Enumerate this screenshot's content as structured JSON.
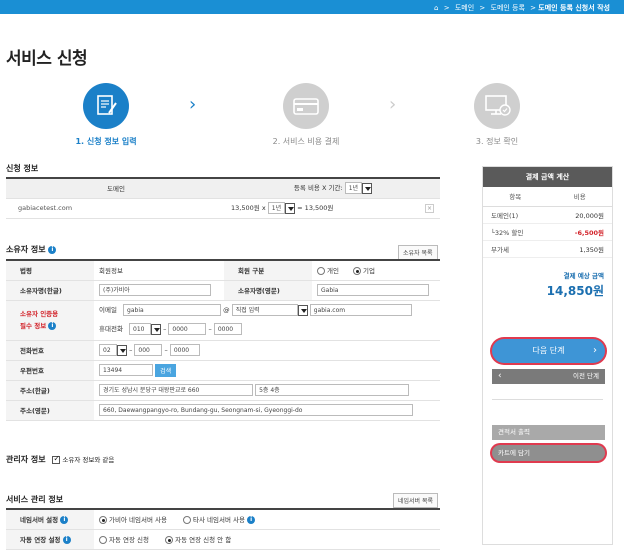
{
  "breadcrumb": {
    "items": [
      "도메인",
      "도메인 등록"
    ],
    "current": "도메인 등록 신청서 작성",
    "sep": ">"
  },
  "page": {
    "title": "서비스 신청"
  },
  "steps": [
    {
      "label": "1. 신청 정보 입력"
    },
    {
      "label": "2. 서비스 비용 결제"
    },
    {
      "label": "3. 정보 확인"
    }
  ],
  "apply": {
    "title": "신청 정보",
    "col_domain": "도메인",
    "col_fee": "등록 비용 X 기간:",
    "period_header": "1년",
    "domain": "gabiacetest.com",
    "price": "13,500원",
    "times": "x",
    "period": "1년",
    "result": "= 13,500원"
  },
  "owner": {
    "title": "소유자 정보",
    "list_button": "소유자 목록",
    "type_label": "법령",
    "type_value": "회원정보",
    "member_type_label": "회원 구분",
    "opt_individual": "개인",
    "opt_company": "기업",
    "name_kr_label": "소유자명(한글)",
    "name_kr": "(주)가비아",
    "name_en_label": "소유자명(영문)",
    "name_en": "Gabia",
    "auth_label_line1": "소유자 인증용",
    "auth_label_line2": "필수 정보",
    "email_label": "이메일",
    "email_id": "gabia",
    "at": "@",
    "email_direct": "직접 입력",
    "email_domain": "gabia.com",
    "mobile_label": "휴대전화",
    "mobile_1": "010",
    "mobile_2": "0000",
    "mobile_3": "0000",
    "dash": "–",
    "phone_label": "전화번호",
    "phone_1": "02",
    "phone_2": "000",
    "phone_3": "0000",
    "zip_label": "우편번호",
    "zip": "13494",
    "search_button": "검색",
    "addr_kr_label": "주소(한글)",
    "addr_kr_1": "경기도 성남시 분당구 대왕판교로 660",
    "addr_kr_2": "5층 4층",
    "addr_en_label": "주소(영문)",
    "addr_en": "660, Daewangpangyo-ro, Bundang-gu, Seongnam-si, Gyeonggi-do"
  },
  "admin": {
    "title": "관리자 정보",
    "same_label": "소유자 정보와 같음"
  },
  "service": {
    "title": "서비스 관리 정보",
    "list_button": "네임서버 목록",
    "ns_label": "네임서버 설정",
    "ns_opt1": "가비아 네임서버 사용",
    "ns_opt2": "타사 네임서버 사용",
    "renew_label": "자동 연장 설정",
    "renew_opt1": "자동 연장 신청",
    "renew_opt2": "자동 연장 신청 안 함"
  },
  "sidebar": {
    "title": "결제 금액 계산",
    "col_item": "항목",
    "col_cost": "비용",
    "rows": [
      {
        "name": "도메인(1)",
        "value": "20,000원"
      },
      {
        "name": "└32% 할인",
        "value": "-6,500원"
      },
      {
        "name": "부가세",
        "value": "1,350원"
      }
    ],
    "total_label": "결제 예상 금액",
    "total_value": "14,850원",
    "next_button": "다음 단계",
    "prev_button": "이전 단계",
    "estimate_button": "견적서 출력",
    "cart_button": "카트에 담기"
  },
  "colors": {
    "accent": "#1b80c8",
    "topbar": "#1a8fd4",
    "red": "#d2232a"
  }
}
